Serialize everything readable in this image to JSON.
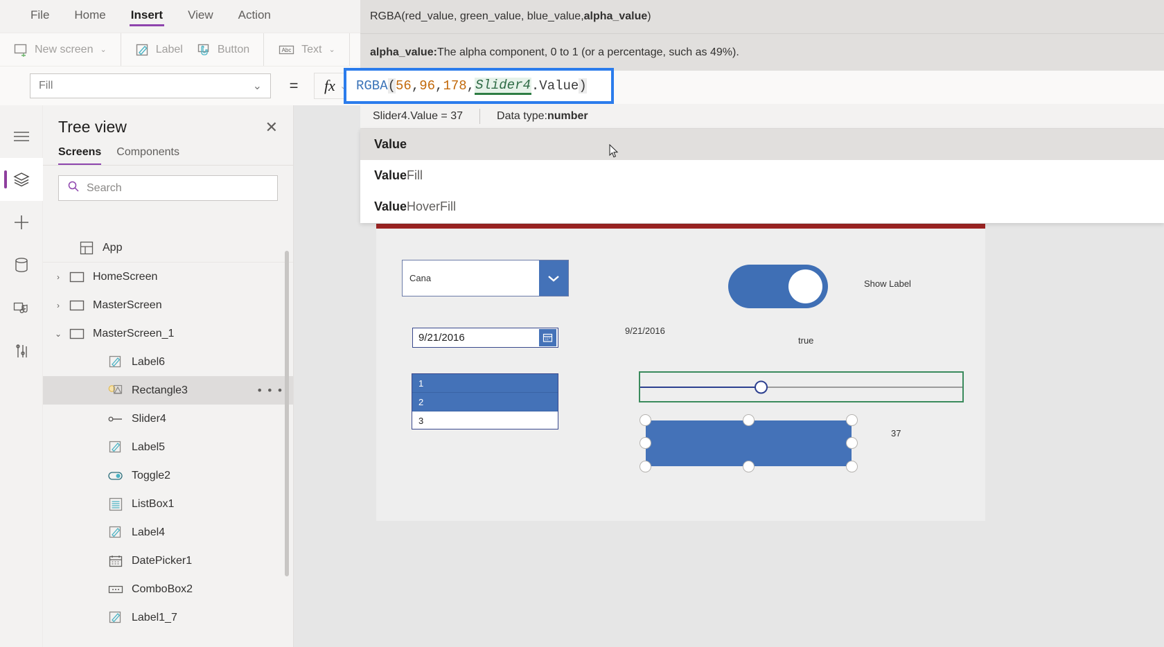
{
  "ribbon": {
    "tabs": [
      {
        "label": "File",
        "active": false
      },
      {
        "label": "Home",
        "active": false
      },
      {
        "label": "Insert",
        "active": true
      },
      {
        "label": "View",
        "active": false
      },
      {
        "label": "Action",
        "active": false
      }
    ],
    "commands": [
      {
        "label": "New screen",
        "icon": "new-screen-icon",
        "caret": "⌄"
      },
      {
        "label": "Label",
        "icon": "label-icon",
        "caret": ""
      },
      {
        "label": "Button",
        "icon": "button-icon",
        "caret": ""
      },
      {
        "label": "Text",
        "icon": "text-icon",
        "caret": "⌄"
      }
    ]
  },
  "property_bar": {
    "selected_property": "Fill",
    "dropdown_caret": "⌄",
    "equals": "=",
    "fx_label": "fx",
    "fx_caret": "⌄"
  },
  "rail": {
    "items": [
      {
        "name": "hamburger-menu-icon",
        "active": false
      },
      {
        "name": "tree-view-icon",
        "active": true
      },
      {
        "name": "insert-icon",
        "active": false
      },
      {
        "name": "data-sources-icon",
        "active": false
      },
      {
        "name": "media-icon",
        "active": false
      },
      {
        "name": "variables-icon",
        "active": false
      }
    ]
  },
  "tree_view": {
    "title": "Tree view",
    "close": "✕",
    "tabs": [
      {
        "label": "Screens",
        "active": true
      },
      {
        "label": "Components",
        "active": false
      }
    ],
    "search_placeholder": "Search",
    "search_value": "",
    "nodes": [
      {
        "label": "App",
        "icon": "app-icon",
        "level": "app",
        "chevron": "",
        "selected": false,
        "dots": false
      },
      {
        "label": "HomeScreen",
        "icon": "screen-icon",
        "level": "screen",
        "chevron": "›",
        "selected": false,
        "dots": false
      },
      {
        "label": "MasterScreen",
        "icon": "screen-icon",
        "level": "screen",
        "chevron": "›",
        "selected": false,
        "dots": false
      },
      {
        "label": "MasterScreen_1",
        "icon": "screen-icon",
        "level": "screen",
        "chevron": "⌄",
        "selected": false,
        "dots": false
      },
      {
        "label": "Label6",
        "icon": "label-icon",
        "level": "child",
        "chevron": "",
        "selected": false,
        "dots": false
      },
      {
        "label": "Rectangle3",
        "icon": "rectangle-icon",
        "level": "child",
        "chevron": "",
        "selected": true,
        "dots": true
      },
      {
        "label": "Slider4",
        "icon": "slider-icon",
        "level": "child",
        "chevron": "",
        "selected": false,
        "dots": false
      },
      {
        "label": "Label5",
        "icon": "label-icon",
        "level": "child",
        "chevron": "",
        "selected": false,
        "dots": false
      },
      {
        "label": "Toggle2",
        "icon": "toggle-icon",
        "level": "child",
        "chevron": "",
        "selected": false,
        "dots": false
      },
      {
        "label": "ListBox1",
        "icon": "listbox-icon",
        "level": "child",
        "chevron": "",
        "selected": false,
        "dots": false
      },
      {
        "label": "Label4",
        "icon": "label-icon",
        "level": "child",
        "chevron": "",
        "selected": false,
        "dots": false
      },
      {
        "label": "DatePicker1",
        "icon": "datepicker-icon",
        "level": "child",
        "chevron": "",
        "selected": false,
        "dots": false
      },
      {
        "label": "ComboBox2",
        "icon": "combobox-icon",
        "level": "child",
        "chevron": "",
        "selected": false,
        "dots": false
      },
      {
        "label": "Label1_7",
        "icon": "label-icon",
        "level": "child",
        "chevron": "",
        "selected": false,
        "dots": false
      }
    ],
    "dots_glyph": "• • •"
  },
  "intellisense": {
    "signature_prefix": "RGBA(red_value, green_value, blue_value, ",
    "signature_bold": "alpha_value",
    "signature_suffix": ")",
    "description_bold": "alpha_value:",
    "description_text": " The alpha component, 0 to 1 (or a percentage, such as 49%).",
    "meta_left": "Slider4.Value  =  37",
    "meta_right_label": "Data type: ",
    "meta_right_value": "number",
    "suggestions": [
      {
        "bold": "Value",
        "rest": "",
        "highlighted": true
      },
      {
        "bold": "Value",
        "rest": "Fill",
        "highlighted": false
      },
      {
        "bold": "Value",
        "rest": "HoverFill",
        "highlighted": false
      }
    ]
  },
  "formula": {
    "tokens": [
      {
        "text": "RGBA",
        "type": "fn"
      },
      {
        "text": "(",
        "type": "punct"
      },
      {
        "text": "56",
        "type": "num"
      },
      {
        "text": ", ",
        "type": "plain"
      },
      {
        "text": "96",
        "type": "num"
      },
      {
        "text": ", ",
        "type": "plain"
      },
      {
        "text": "178",
        "type": "num"
      },
      {
        "text": ", ",
        "type": "plain"
      },
      {
        "text": "Slider4",
        "type": "ctrl"
      },
      {
        "text": ".Value",
        "type": "plain"
      },
      {
        "text": ")",
        "type": "punct"
      }
    ],
    "full_text": "RGBA(56, 96, 178, Slider4.Value)"
  },
  "canvas": {
    "topbar_color": "#9c2423",
    "combobox": {
      "value": "Cana",
      "caret": "⌄"
    },
    "datepicker": {
      "value": "9/21/2016",
      "icon": "calendar-icon"
    },
    "listbox": {
      "items": [
        {
          "label": "1",
          "selected": true
        },
        {
          "label": "2",
          "selected": true
        },
        {
          "label": "3",
          "selected": false
        }
      ]
    },
    "toggle": {
      "state_on": true
    },
    "labels": {
      "show_label": "Show Label",
      "date_echo": "9/21/2016",
      "toggle_echo": "true",
      "slider_echo": "37"
    },
    "slider": {
      "value": 37,
      "fill_percent": 37
    },
    "rectangle": {
      "fill": "#4472b8",
      "selected": true
    }
  },
  "colors": {
    "accent_purple": "#8e44ad",
    "selection_blue": "#2b7cec",
    "control_blue": "#4472b8",
    "slider_green_border": "#3a8a5c",
    "canvas_red": "#9c2423"
  }
}
